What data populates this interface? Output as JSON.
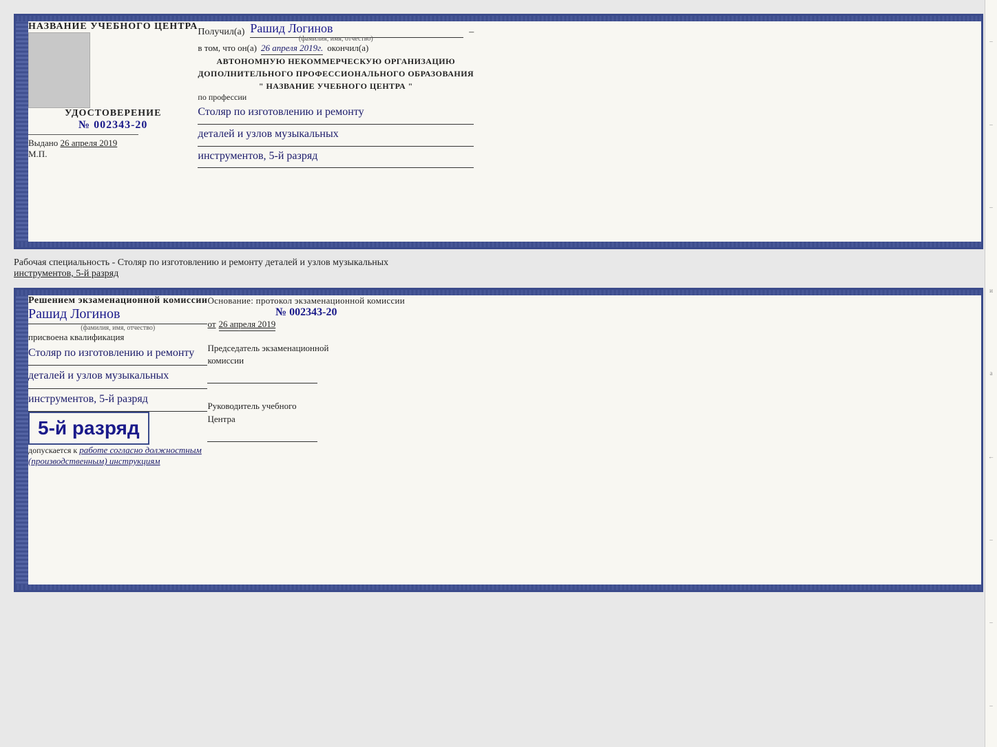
{
  "top_card": {
    "left": {
      "title": "НАЗВАНИЕ УЧЕБНОГО ЦЕНТРА",
      "photo_alt": "photo",
      "udost_label": "УДОСТОВЕРЕНИЕ",
      "number_prefix": "№",
      "number": "002343-20",
      "vydano_label": "Выдано",
      "vydano_date": "26 апреля 2019",
      "mp_label": "М.П."
    },
    "right": {
      "poluchil_label": "Получил(а)",
      "recipient_name": "Рашид Логинов",
      "fio_label": "(фамилия, имя, отчество)",
      "dash": "–",
      "vtom_label": "в том, что он(а)",
      "vtom_date": "26 апреля 2019г.",
      "okonchil_label": "окончил(а)",
      "org_line1": "АВТОНОМНУЮ НЕКОММЕРЧЕСКУЮ ОРГАНИЗАЦИЮ",
      "org_line2": "ДОПОЛНИТЕЛЬНОГО ПРОФЕССИОНАЛЬНОГО ОБРАЗОВАНИЯ",
      "org_line3": "\"  НАЗВАНИЕ УЧЕБНОГО ЦЕНТРА  \"",
      "po_professii": "по профессии",
      "profession_line1": "Столяр по изготовлению и ремонту",
      "profession_line2": "деталей и узлов музыкальных",
      "profession_line3": "инструментов, 5-й разряд",
      "right_marks": [
        "–",
        "–",
        "–",
        "и",
        "а",
        "←",
        "–"
      ]
    }
  },
  "subtitle": {
    "text_normal": "Рабочая специальность - Столяр по изготовлению и ремонту деталей и узлов музыкальных",
    "text_underlined": "инструментов, 5-й разряд"
  },
  "bottom_card": {
    "left": {
      "resheniem_label": "Решением экзаменационной комиссии",
      "name_cursive": "Рашид Логинов",
      "fio_label": "(фамилия, имя, отчество)",
      "prisvoyena_label": "присвоена квалификация",
      "kval_line1": "Столяр по изготовлению и ремонту",
      "kval_line2": "деталей и узлов музыкальных",
      "kval_line3": "инструментов, 5-й разряд",
      "big_razryad": "5-й разряд",
      "dopusk_label": "допускается к",
      "dopusk_text": "работе согласно должностным",
      "dopusk_text2": "(производственным) инструкциям"
    },
    "right": {
      "osnovanie_label": "Основание: протокол экзаменационной комиссии",
      "number_prefix": "№",
      "protocol_number": "002343-20",
      "ot_label": "от",
      "ot_date": "26 апреля 2019",
      "chairman_label": "Председатель экзаменационной",
      "chairman_label2": "комиссии",
      "rukovoditel_label": "Руководитель учебного",
      "rukovoditel_label2": "Центра",
      "right_marks": [
        "–",
        "–",
        "–",
        "и",
        "а",
        "←",
        "–",
        "–",
        "–"
      ]
    }
  }
}
